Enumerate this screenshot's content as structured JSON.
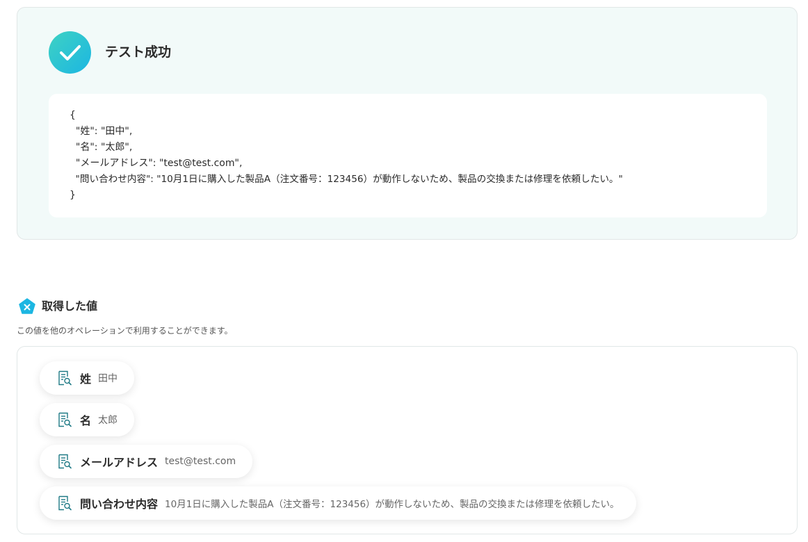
{
  "test_result": {
    "title": "テスト成功",
    "json_lines": [
      "{",
      "  \"姓\": \"田中\",",
      "  \"名\": \"太郎\",",
      "  \"メールアドレス\": \"test@test.com\",",
      "  \"問い合わせ内容\": \"10月1日に購入した製品A（注文番号：123456）が動作しないため、製品の交換または修理を依頼したい。\"",
      "}"
    ]
  },
  "acquired": {
    "title": "取得した値",
    "subtitle": "この値を他のオペレーションで利用することができます。",
    "items": [
      {
        "label": "姓",
        "value": "田中"
      },
      {
        "label": "名",
        "value": "太郎"
      },
      {
        "label": "メールアドレス",
        "value": "test@test.com"
      },
      {
        "label": "問い合わせ内容",
        "value": "10月1日に購入した製品A（注文番号：123456）が動作しないため、製品の交換または修理を依頼したい。"
      }
    ]
  },
  "icons": {
    "success": "check-circle-icon",
    "section": "pentagon-x-icon",
    "item": "document-search-icon"
  },
  "colors": {
    "accent_start": "#3ed2c3",
    "accent_end": "#1cb6e2",
    "panel_bg": "#f2faf9",
    "icon_teal": "#1f7a86"
  }
}
